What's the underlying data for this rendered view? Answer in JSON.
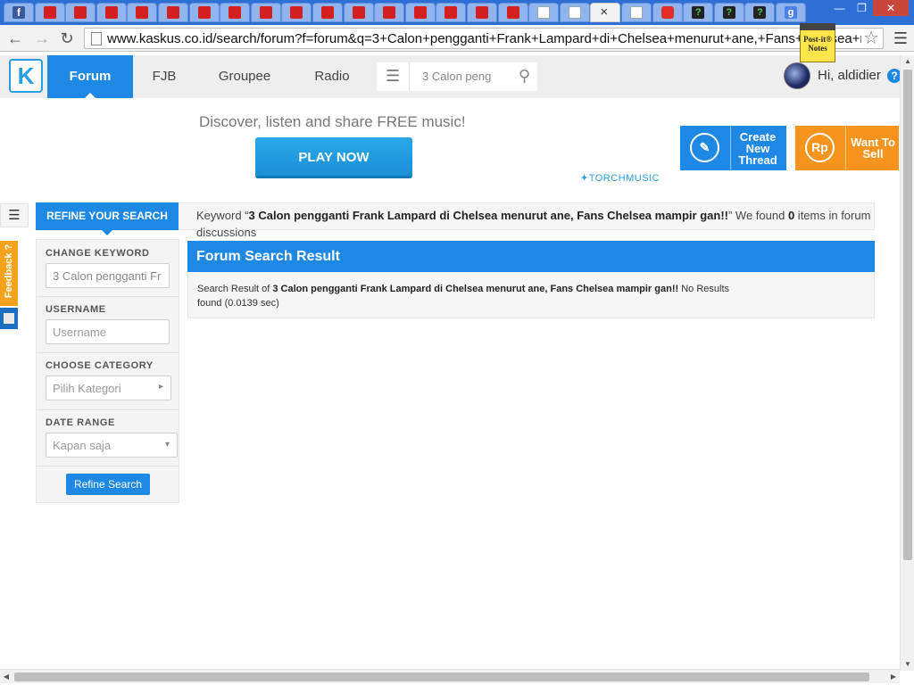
{
  "browser": {
    "url": "www.kaskus.co.id/search/forum?f=forum&q=3+Calon+pengganti+Frank+Lampard+di+Chelsea+menurut+ane,+Fans+Chelsea+mampir+gan!!",
    "tab_close_glyph": "×",
    "tabs": [
      {
        "icon": "facebook-icon",
        "glyph": "f"
      },
      {
        "icon": "red-book-icon"
      },
      {
        "icon": "red-book-icon"
      },
      {
        "icon": "red-book-icon"
      },
      {
        "icon": "red-book-icon"
      },
      {
        "icon": "red-book-icon"
      },
      {
        "icon": "red-book-icon"
      },
      {
        "icon": "red-book-icon"
      },
      {
        "icon": "red-book-icon"
      },
      {
        "icon": "red-book-icon"
      },
      {
        "icon": "red-book-icon"
      },
      {
        "icon": "red-book-icon"
      },
      {
        "icon": "red-book-icon"
      },
      {
        "icon": "red-book-icon"
      },
      {
        "icon": "red-book-icon"
      },
      {
        "icon": "red-book-icon"
      },
      {
        "icon": "red-book-icon"
      },
      {
        "icon": "document-icon"
      },
      {
        "icon": "document-icon"
      },
      {
        "icon": "active-tab",
        "active": true
      },
      {
        "icon": "document-icon"
      },
      {
        "icon": "youtube-icon"
      },
      {
        "icon": "q-icon",
        "glyph": "?"
      },
      {
        "icon": "q-icon",
        "glyph": "?"
      },
      {
        "icon": "q-icon",
        "glyph": "?"
      },
      {
        "icon": "google-icon",
        "glyph": "g"
      }
    ],
    "postit_label": "Post-it® Notes"
  },
  "header": {
    "nav": [
      "Forum",
      "FJB",
      "Groupee",
      "Radio"
    ],
    "search_value": "3 Calon peng",
    "greeting": "Hi, aldidier"
  },
  "banner": {
    "promo": "Discover, listen and share FREE music!",
    "play_button": "PLAY NOW",
    "torch_logo": "TORCHMUSIC",
    "create_thread": "Create New Thread",
    "want_to_sell": "Want To Sell",
    "rp_symbol": "Rp"
  },
  "sidebar": {
    "feedback": "Feedback ?"
  },
  "refine": {
    "header": "REFINE YOUR SEARCH",
    "change_keyword_label": "CHANGE KEYWORD",
    "keyword_value": "3 Calon pengganti Fr",
    "username_label": "USERNAME",
    "username_placeholder": "Username",
    "category_label": "CHOOSE CATEGORY",
    "category_value": "Pilih Kategori",
    "date_label": "DATE RANGE",
    "date_value": "Kapan saja",
    "button": "Refine Search"
  },
  "results": {
    "keyword_prefix": "Keyword “",
    "query": "3 Calon pengganti Frank Lampard di Chelsea menurut ane, Fans Chelsea mampir gan!!",
    "keyword_suffix": "” We found ",
    "count": "0",
    "keyword_tail": " items in forum discussions",
    "title": "Forum Search Result",
    "result_prefix": "Search Result of ",
    "result_suffix": " No Results found (0.0139 sec)"
  },
  "colors": {
    "primary": "#1e88e5",
    "accent": "#f7941d",
    "header_bg": "#eeeeee"
  }
}
